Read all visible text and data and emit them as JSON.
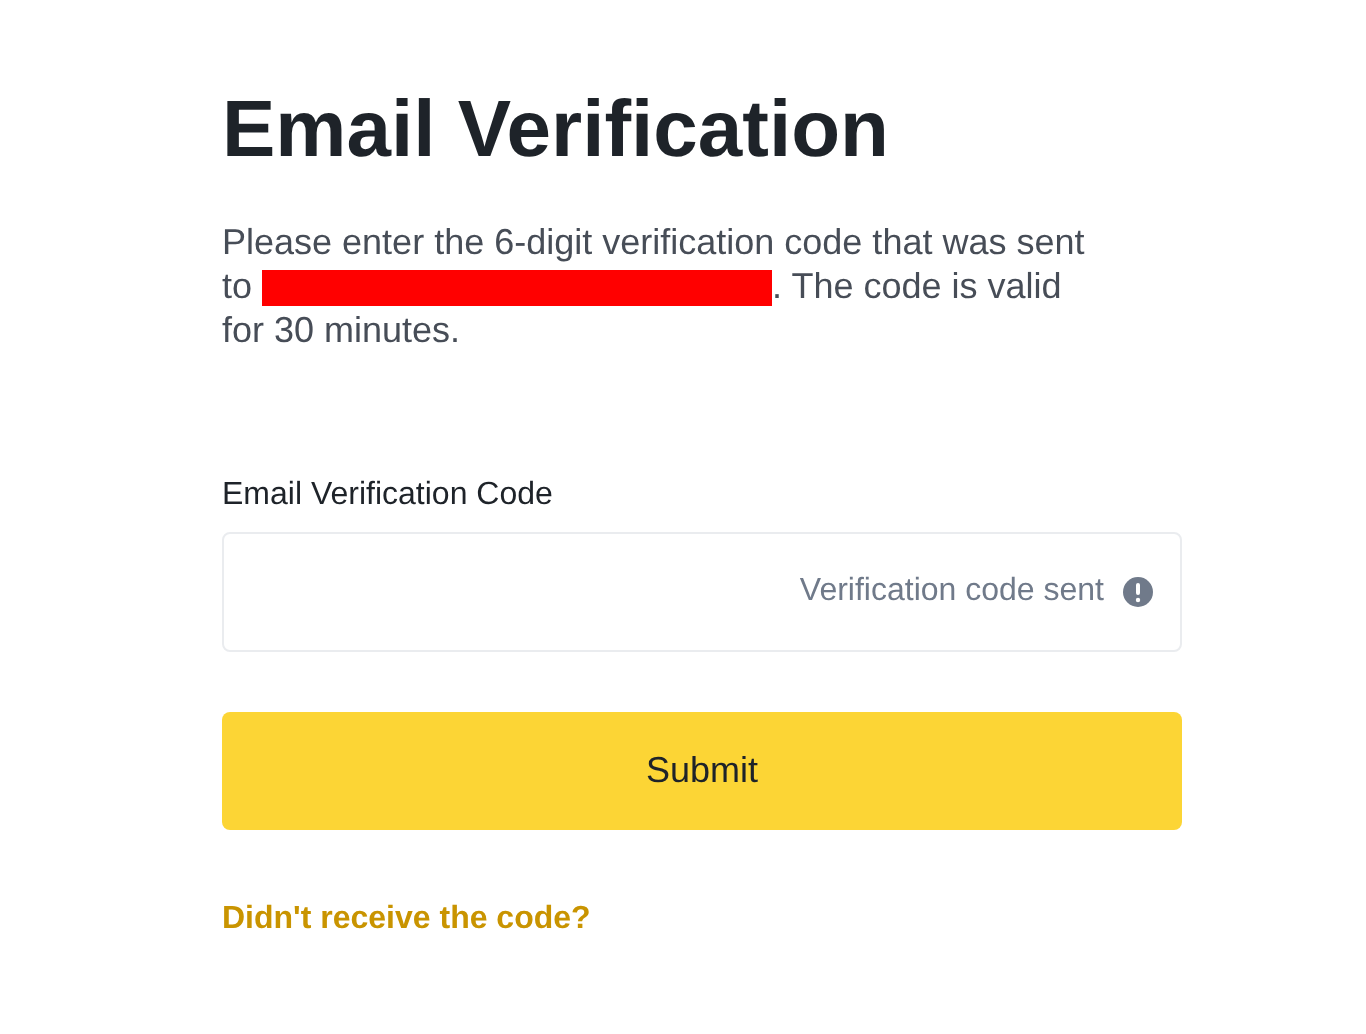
{
  "title": "Email Verification",
  "message": {
    "before": "Please enter the 6-digit verification code that was sent to ",
    "redacted": true,
    "after": ". The code is valid for 30 minutes."
  },
  "field": {
    "label": "Email Verification Code",
    "hint": "Verification code sent"
  },
  "submit": "Submit",
  "resend_link": "Didn't receive the code?"
}
